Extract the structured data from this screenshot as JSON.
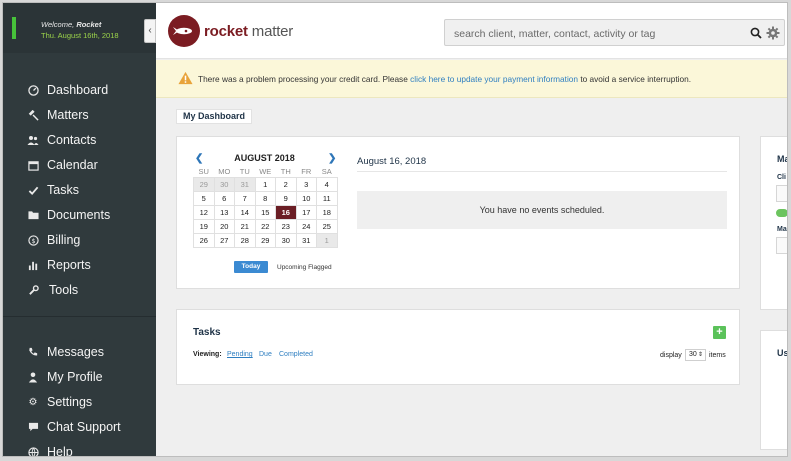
{
  "welcome": {
    "greeting": "Welcome,",
    "user": "Rocket",
    "date": "Thu. August 16th, 2018"
  },
  "sidebar": {
    "items": [
      {
        "label": "Dashboard",
        "icon": "dashboard-icon"
      },
      {
        "label": "Matters",
        "icon": "gavel-icon"
      },
      {
        "label": "Contacts",
        "icon": "contacts-icon"
      },
      {
        "label": "Calendar",
        "icon": "calendar-icon"
      },
      {
        "label": "Tasks",
        "icon": "check-icon"
      },
      {
        "label": "Documents",
        "icon": "folder-icon"
      },
      {
        "label": "Billing",
        "icon": "dollar-icon"
      },
      {
        "label": "Reports",
        "icon": "bar-chart-icon"
      },
      {
        "label": "Tools",
        "icon": "wrench-icon"
      }
    ],
    "bottom_items": [
      {
        "label": "Messages",
        "icon": "phone-icon"
      },
      {
        "label": "My Profile",
        "icon": "user-icon"
      },
      {
        "label": "Settings",
        "icon": "gear-icon"
      },
      {
        "label": "Chat Support",
        "icon": "chat-icon"
      },
      {
        "label": "Help",
        "icon": "globe-icon"
      }
    ]
  },
  "header": {
    "logo_brand": "rocket",
    "logo_rest": " matter",
    "search_placeholder": "search client, matter, contact, activity or tag"
  },
  "alert": {
    "before": "There was a problem processing your credit card. Please ",
    "link": "click here to update your payment information",
    "after": " to avoid a service interruption."
  },
  "dashboard": {
    "title": "My Dashboard"
  },
  "calendar": {
    "month_label": "AUGUST 2018",
    "weekdays": [
      "SU",
      "MO",
      "TU",
      "WE",
      "TH",
      "FR",
      "SA"
    ],
    "weeks": [
      [
        "29",
        "30",
        "31",
        "1",
        "2",
        "3",
        "4"
      ],
      [
        "5",
        "6",
        "7",
        "8",
        "9",
        "10",
        "11"
      ],
      [
        "12",
        "13",
        "14",
        "15",
        "16",
        "17",
        "18"
      ],
      [
        "19",
        "20",
        "21",
        "22",
        "23",
        "24",
        "25"
      ],
      [
        "26",
        "27",
        "28",
        "29",
        "30",
        "31",
        "1"
      ]
    ],
    "today_button": "Today",
    "upcoming_flagged": "Upcoming Flagged",
    "selected_date": "August 16, 2018",
    "no_events": "You have no events scheduled."
  },
  "tasks": {
    "title": "Tasks",
    "viewing_label": "Viewing:",
    "filters": [
      "Pending",
      "Due",
      "Completed"
    ],
    "display_label": "display",
    "display_value": "30",
    "items_label": "items"
  },
  "right_panel": {
    "title_partial": "Ma",
    "label1_partial": "Cli",
    "label2_partial": "Ma",
    "title2_partial": "Us"
  },
  "colors": {
    "sidebar": "#303a3d",
    "brand": "#7b1c22",
    "accent": "#47c23a",
    "link": "#2f7fc1",
    "alert_bg": "#fbf7d9"
  }
}
